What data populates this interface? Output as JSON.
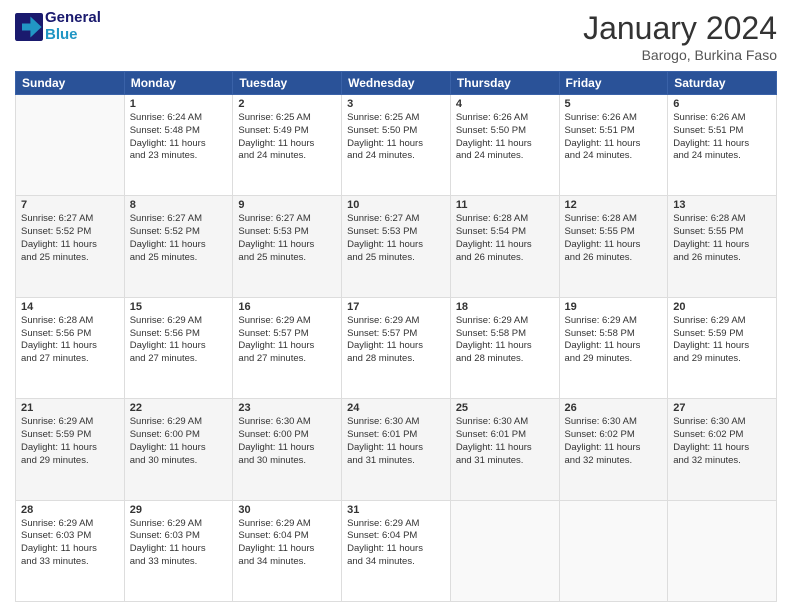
{
  "header": {
    "logo_line1": "General",
    "logo_line2": "Blue",
    "month_title": "January 2024",
    "location": "Barogo, Burkina Faso"
  },
  "weekdays": [
    "Sunday",
    "Monday",
    "Tuesday",
    "Wednesday",
    "Thursday",
    "Friday",
    "Saturday"
  ],
  "weeks": [
    [
      {
        "day": "",
        "info": ""
      },
      {
        "day": "1",
        "info": "Sunrise: 6:24 AM\nSunset: 5:48 PM\nDaylight: 11 hours\nand 23 minutes."
      },
      {
        "day": "2",
        "info": "Sunrise: 6:25 AM\nSunset: 5:49 PM\nDaylight: 11 hours\nand 24 minutes."
      },
      {
        "day": "3",
        "info": "Sunrise: 6:25 AM\nSunset: 5:50 PM\nDaylight: 11 hours\nand 24 minutes."
      },
      {
        "day": "4",
        "info": "Sunrise: 6:26 AM\nSunset: 5:50 PM\nDaylight: 11 hours\nand 24 minutes."
      },
      {
        "day": "5",
        "info": "Sunrise: 6:26 AM\nSunset: 5:51 PM\nDaylight: 11 hours\nand 24 minutes."
      },
      {
        "day": "6",
        "info": "Sunrise: 6:26 AM\nSunset: 5:51 PM\nDaylight: 11 hours\nand 24 minutes."
      }
    ],
    [
      {
        "day": "7",
        "info": "Sunrise: 6:27 AM\nSunset: 5:52 PM\nDaylight: 11 hours\nand 25 minutes."
      },
      {
        "day": "8",
        "info": "Sunrise: 6:27 AM\nSunset: 5:52 PM\nDaylight: 11 hours\nand 25 minutes."
      },
      {
        "day": "9",
        "info": "Sunrise: 6:27 AM\nSunset: 5:53 PM\nDaylight: 11 hours\nand 25 minutes."
      },
      {
        "day": "10",
        "info": "Sunrise: 6:27 AM\nSunset: 5:53 PM\nDaylight: 11 hours\nand 25 minutes."
      },
      {
        "day": "11",
        "info": "Sunrise: 6:28 AM\nSunset: 5:54 PM\nDaylight: 11 hours\nand 26 minutes."
      },
      {
        "day": "12",
        "info": "Sunrise: 6:28 AM\nSunset: 5:55 PM\nDaylight: 11 hours\nand 26 minutes."
      },
      {
        "day": "13",
        "info": "Sunrise: 6:28 AM\nSunset: 5:55 PM\nDaylight: 11 hours\nand 26 minutes."
      }
    ],
    [
      {
        "day": "14",
        "info": "Sunrise: 6:28 AM\nSunset: 5:56 PM\nDaylight: 11 hours\nand 27 minutes."
      },
      {
        "day": "15",
        "info": "Sunrise: 6:29 AM\nSunset: 5:56 PM\nDaylight: 11 hours\nand 27 minutes."
      },
      {
        "day": "16",
        "info": "Sunrise: 6:29 AM\nSunset: 5:57 PM\nDaylight: 11 hours\nand 27 minutes."
      },
      {
        "day": "17",
        "info": "Sunrise: 6:29 AM\nSunset: 5:57 PM\nDaylight: 11 hours\nand 28 minutes."
      },
      {
        "day": "18",
        "info": "Sunrise: 6:29 AM\nSunset: 5:58 PM\nDaylight: 11 hours\nand 28 minutes."
      },
      {
        "day": "19",
        "info": "Sunrise: 6:29 AM\nSunset: 5:58 PM\nDaylight: 11 hours\nand 29 minutes."
      },
      {
        "day": "20",
        "info": "Sunrise: 6:29 AM\nSunset: 5:59 PM\nDaylight: 11 hours\nand 29 minutes."
      }
    ],
    [
      {
        "day": "21",
        "info": "Sunrise: 6:29 AM\nSunset: 5:59 PM\nDaylight: 11 hours\nand 29 minutes."
      },
      {
        "day": "22",
        "info": "Sunrise: 6:29 AM\nSunset: 6:00 PM\nDaylight: 11 hours\nand 30 minutes."
      },
      {
        "day": "23",
        "info": "Sunrise: 6:30 AM\nSunset: 6:00 PM\nDaylight: 11 hours\nand 30 minutes."
      },
      {
        "day": "24",
        "info": "Sunrise: 6:30 AM\nSunset: 6:01 PM\nDaylight: 11 hours\nand 31 minutes."
      },
      {
        "day": "25",
        "info": "Sunrise: 6:30 AM\nSunset: 6:01 PM\nDaylight: 11 hours\nand 31 minutes."
      },
      {
        "day": "26",
        "info": "Sunrise: 6:30 AM\nSunset: 6:02 PM\nDaylight: 11 hours\nand 32 minutes."
      },
      {
        "day": "27",
        "info": "Sunrise: 6:30 AM\nSunset: 6:02 PM\nDaylight: 11 hours\nand 32 minutes."
      }
    ],
    [
      {
        "day": "28",
        "info": "Sunrise: 6:29 AM\nSunset: 6:03 PM\nDaylight: 11 hours\nand 33 minutes."
      },
      {
        "day": "29",
        "info": "Sunrise: 6:29 AM\nSunset: 6:03 PM\nDaylight: 11 hours\nand 33 minutes."
      },
      {
        "day": "30",
        "info": "Sunrise: 6:29 AM\nSunset: 6:04 PM\nDaylight: 11 hours\nand 34 minutes."
      },
      {
        "day": "31",
        "info": "Sunrise: 6:29 AM\nSunset: 6:04 PM\nDaylight: 11 hours\nand 34 minutes."
      },
      {
        "day": "",
        "info": ""
      },
      {
        "day": "",
        "info": ""
      },
      {
        "day": "",
        "info": ""
      }
    ]
  ]
}
